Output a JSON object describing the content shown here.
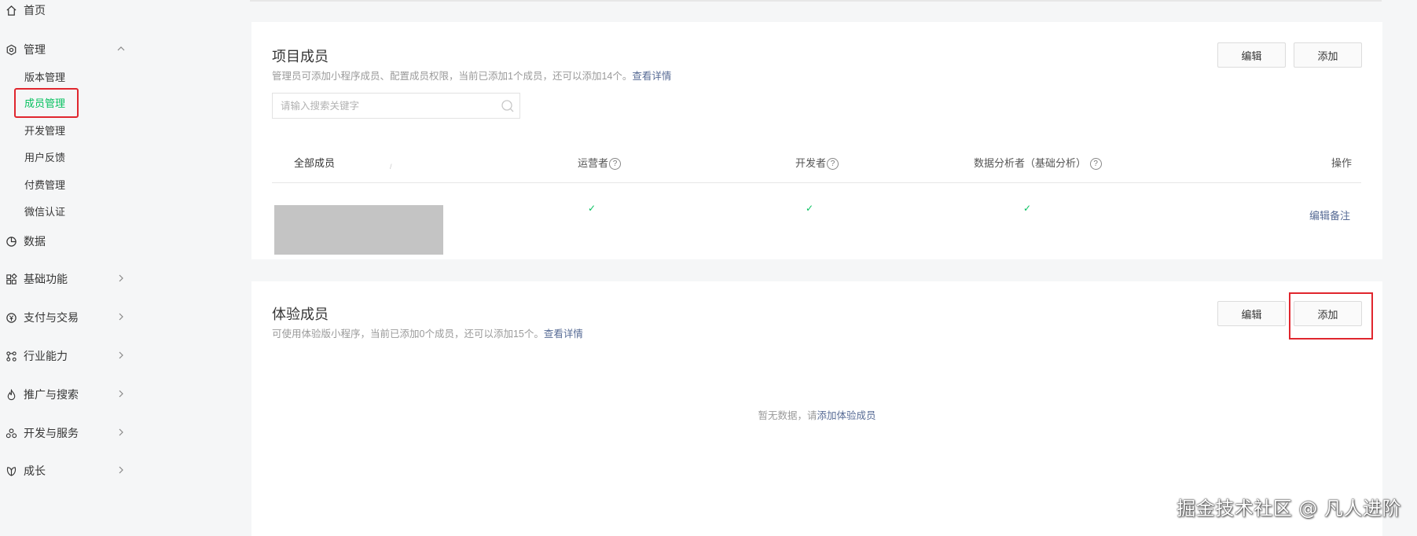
{
  "sidebar": {
    "home": "首页",
    "manage": "管理",
    "manage_items": [
      "版本管理",
      "成员管理",
      "开发管理",
      "用户反馈",
      "付费管理",
      "微信认证"
    ],
    "active_item": "成员管理",
    "data": "数据",
    "groups": [
      "基础功能",
      "支付与交易",
      "行业能力",
      "推广与搜索",
      "开发与服务",
      "成长"
    ]
  },
  "project_members": {
    "title": "项目成员",
    "desc": "管理员可添加小程序成员、配置成员权限，当前已添加1个成员，还可以添加14个。",
    "desc_link": "查看详情",
    "edit_label": "编辑",
    "add_label": "添加",
    "search_placeholder": "请输入搜索关键字",
    "columns": {
      "all": "全部成员",
      "operator": "运营者",
      "developer": "开发者",
      "analyst": "数据分析者（基础分析）",
      "actions": "操作",
      "help_glyph": "?"
    },
    "row": {
      "operator": "✓",
      "developer": "✓",
      "analyst": "✓",
      "action": "编辑备注"
    }
  },
  "trial_members": {
    "title": "体验成员",
    "desc": "可使用体验版小程序，当前已添加0个成员，还可以添加15个。",
    "desc_link": "查看详情",
    "edit_label": "编辑",
    "add_label": "添加",
    "empty_text": "暂无数据，请",
    "empty_link": "添加体验成员"
  },
  "watermark": "掘金技术社区 @ 凡人进阶",
  "colors": {
    "accent_green": "#07c160",
    "link_blue": "#576b95",
    "highlight_red": "#e0262e"
  }
}
